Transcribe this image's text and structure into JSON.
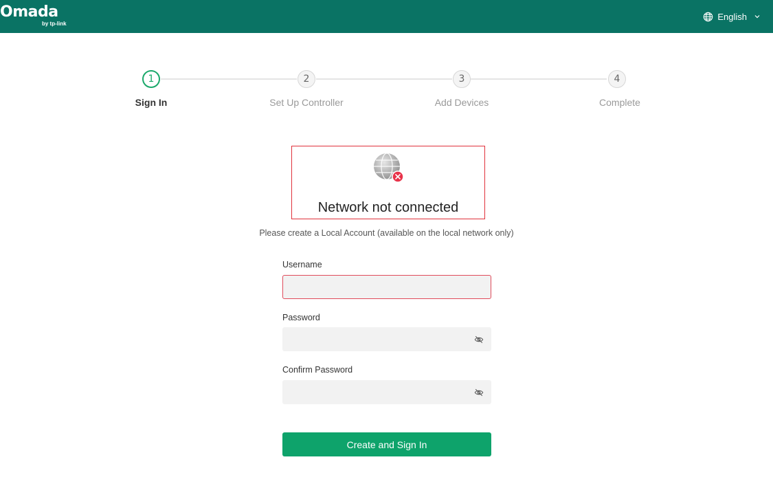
{
  "header": {
    "logo_text": "Omada",
    "logo_sub": "by tp-link",
    "language": "English",
    "background_color": "#0a7364"
  },
  "stepper": {
    "active_step": 1,
    "accent_color": "#1aa86a",
    "steps": [
      {
        "number": "1",
        "label": "Sign In"
      },
      {
        "number": "2",
        "label": "Set Up Controller"
      },
      {
        "number": "3",
        "label": "Add Devices"
      },
      {
        "number": "4",
        "label": "Complete"
      }
    ]
  },
  "status": {
    "icon": "globe-disconnected-icon",
    "title": "Network not connected",
    "error_color": "#e0303a"
  },
  "subtitle": "Please create a Local Account (available on the local network only)",
  "form": {
    "username_label": "Username",
    "username_value": "",
    "password_label": "Password",
    "password_value": "",
    "confirm_label": "Confirm Password",
    "confirm_value": "",
    "submit_label": "Create and Sign In",
    "submit_color": "#0ea36b"
  }
}
